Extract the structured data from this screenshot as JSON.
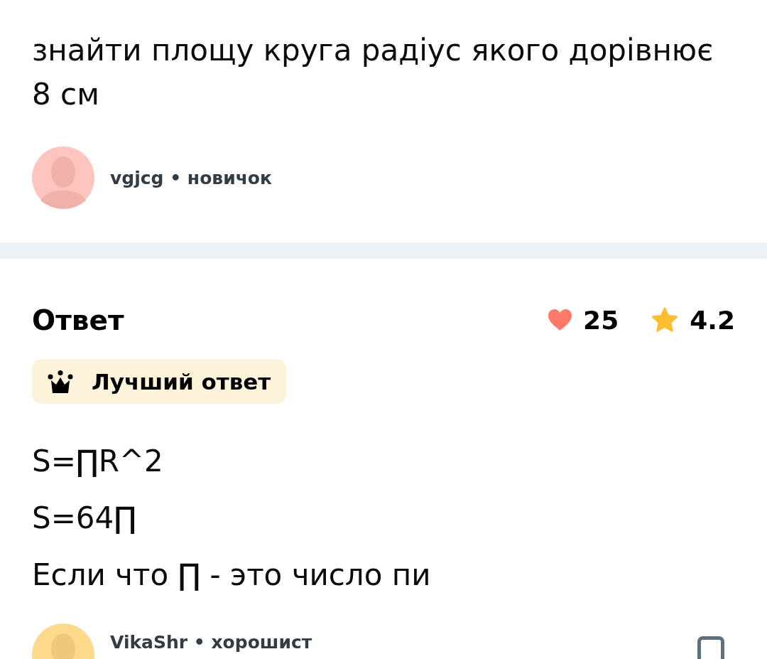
{
  "question": {
    "text": "знайти площу круга радіус якого дорівнює 8 см",
    "author": "vgjcg • новичок"
  },
  "answer": {
    "heading": "Ответ",
    "likes": "25",
    "rating": "4.2",
    "badge": "Лучший ответ",
    "lines": [
      "S=∏R^2",
      "S=64∏",
      "Если что ∏ - это число пи"
    ],
    "author": "VikaShr • хорошист"
  }
}
